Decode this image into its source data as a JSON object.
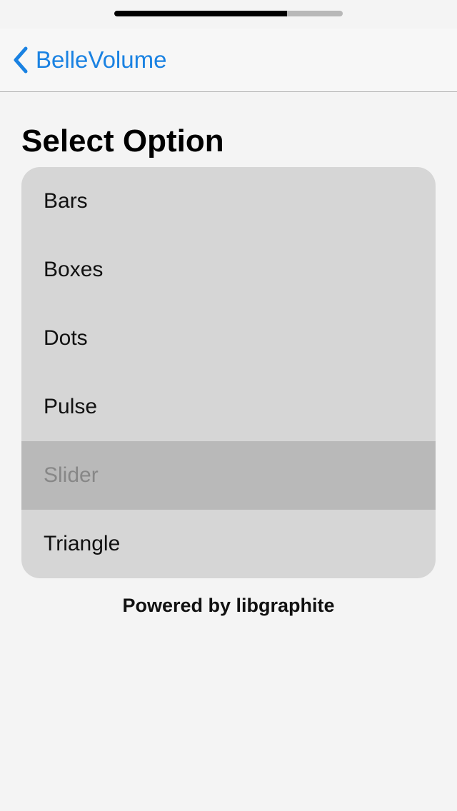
{
  "volume_indicator": {
    "level": 0.755,
    "fill_color": "#000000",
    "track_color": "#b8b8b8"
  },
  "nav": {
    "back_label": "BelleVolume",
    "back_icon": "chevron-left-icon",
    "accent_color": "#1a82e2"
  },
  "page": {
    "title": "Select Option"
  },
  "options": [
    {
      "label": "Bars",
      "enabled": true
    },
    {
      "label": "Boxes",
      "enabled": true
    },
    {
      "label": "Dots",
      "enabled": true
    },
    {
      "label": "Pulse",
      "enabled": true
    },
    {
      "label": "Slider",
      "enabled": false
    },
    {
      "label": "Triangle",
      "enabled": true
    }
  ],
  "footer": {
    "text": "Powered by libgraphite"
  }
}
